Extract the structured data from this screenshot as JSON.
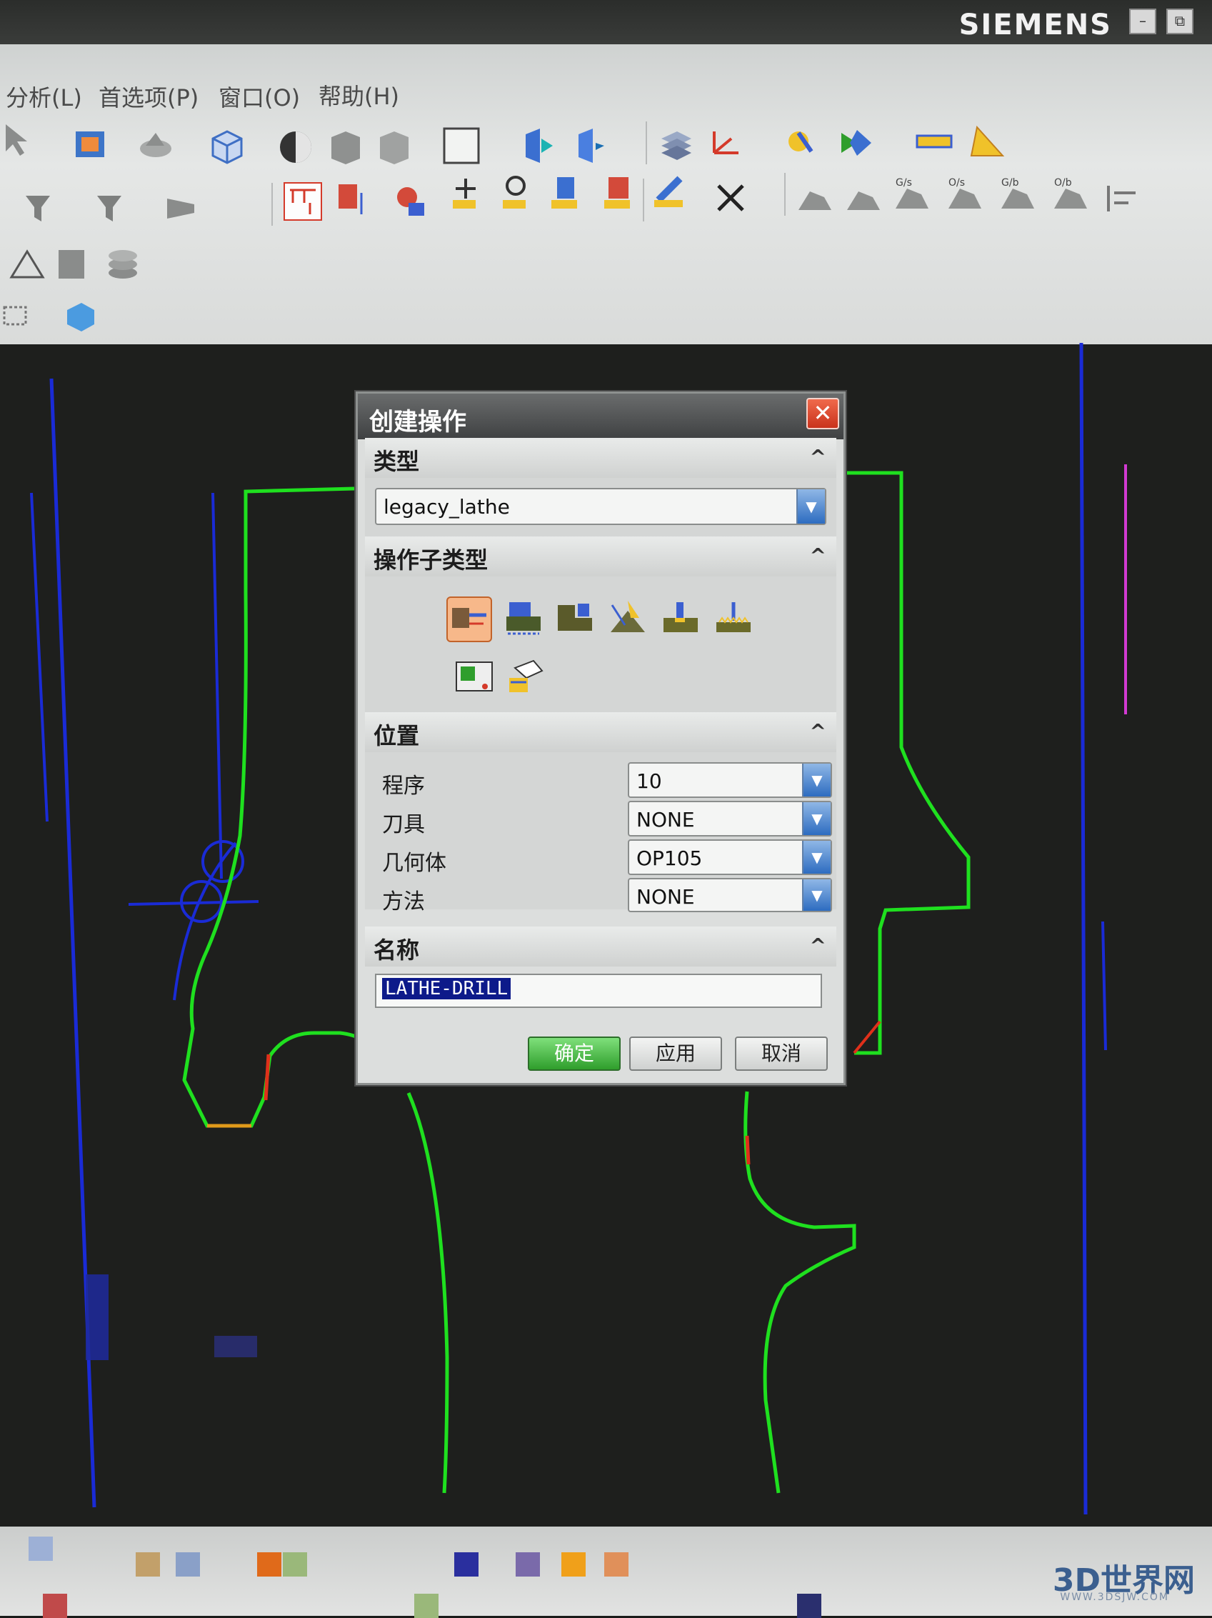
{
  "window": {
    "brand": "SIEMENS",
    "controls": {
      "minimize": "–",
      "restore": "⧉"
    }
  },
  "menubar": {
    "items": [
      "分析(L)",
      "首选项(P)",
      "窗口(O)",
      "帮助(H)"
    ]
  },
  "dialog": {
    "title": "创建操作",
    "close_icon": "close-icon",
    "sections": {
      "type": {
        "label": "类型",
        "value": "legacy_lathe"
      },
      "subtype": {
        "label": "操作子类型"
      },
      "location": {
        "label": "位置",
        "rows": [
          {
            "label": "程序",
            "value": "10"
          },
          {
            "label": "刀具",
            "value": "NONE"
          },
          {
            "label": "几何体",
            "value": "OP105"
          },
          {
            "label": "方法",
            "value": "NONE"
          }
        ]
      },
      "name": {
        "label": "名称",
        "value": "LATHE-DRILL"
      }
    },
    "buttons": {
      "ok": "确定",
      "apply": "应用",
      "cancel": "取消"
    }
  },
  "watermark": {
    "main": "3D世界网",
    "sub": "WWW.3DSJW.COM"
  },
  "colors": {
    "cad_green": "#1fe01f",
    "cad_blue": "#1a2bd6",
    "cad_magenta": "#d23ad2",
    "cad_red": "#e0301a",
    "ok_button": "#3aa83a",
    "arrow_blue": "#2d6cc0"
  }
}
